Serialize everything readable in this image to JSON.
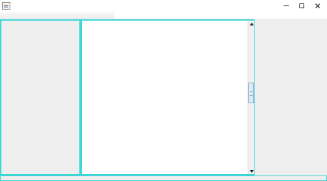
{
  "window": {
    "title": "",
    "controls": {
      "minimize": "minimize-icon",
      "maximize": "maximize-icon",
      "close": "close-icon"
    },
    "close_glyph": "✕"
  },
  "colors": {
    "panel_border": "#3fd6d6",
    "panel_background": "#eeeeee",
    "editor_background": "#ffffff"
  },
  "editor": {
    "text": "",
    "scrollbar": {
      "has_up_arrow": true,
      "has_down_arrow": true
    }
  }
}
